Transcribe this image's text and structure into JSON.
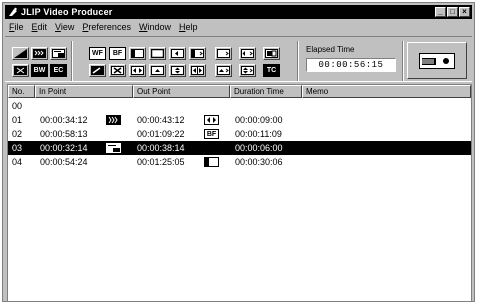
{
  "window": {
    "title": "JLIP Video Producer"
  },
  "title_buttons": [
    "_",
    "□",
    "×"
  ],
  "menu": [
    "File",
    "Edit",
    "View",
    "Preferences",
    "Window",
    "Help"
  ],
  "toolbar": {
    "row1": [
      "diagonal-wipe",
      "mosaic",
      "picture-in-picture",
      "WF",
      "BF",
      "wipe-corner",
      "box-wipe",
      "slide-left",
      "wipe-right",
      "box-out",
      "slide-h",
      "stretch",
      "page-flip"
    ],
    "row2": [
      "strobe",
      "BW",
      "EC",
      "paint",
      "mosaic-x",
      "slide-lr",
      "slide-up",
      "slide-ud",
      "stretch-lr",
      "slide-up-r",
      "stretch-ud",
      "TC"
    ]
  },
  "elapsed": {
    "label": "Elapsed Time",
    "value": "00:00:56:15"
  },
  "table": {
    "columns": [
      "No.",
      "In Point",
      "Out Point",
      "Duration Time",
      "Memo"
    ],
    "rows": [
      {
        "no": "00",
        "in": "",
        "in_icon": "",
        "out": "",
        "out_icon": "",
        "dur": "",
        "memo": ""
      },
      {
        "no": "01",
        "in": "00:00:34:12",
        "in_icon": "mosaic",
        "out": "00:00:43:12",
        "out_icon": "slide-lr",
        "dur": "00:00:09:00",
        "memo": ""
      },
      {
        "no": "02",
        "in": "00:00:58:13",
        "in_icon": "",
        "out": "00:01:09:22",
        "out_icon": "BF",
        "dur": "00:00:11:09",
        "memo": ""
      },
      {
        "no": "03",
        "in": "00:00:32:14",
        "in_icon": "picture-in-picture",
        "out": "00:00:38:14",
        "out_icon": "",
        "dur": "00:00:06:00",
        "memo": ""
      },
      {
        "no": "04",
        "in": "00:00:54:24",
        "in_icon": "",
        "out": "00:01:25:05",
        "out_icon": "wipe-corner",
        "dur": "00:00:30:06",
        "memo": ""
      }
    ],
    "selected_row": "03"
  }
}
